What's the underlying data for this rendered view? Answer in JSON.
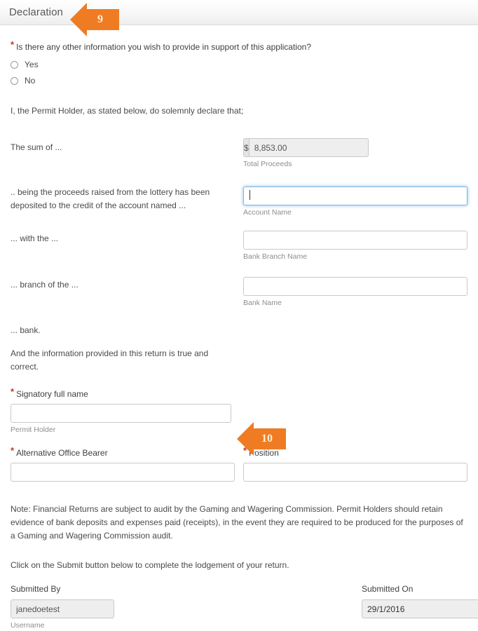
{
  "section": {
    "title": "Declaration"
  },
  "callouts": [
    {
      "number": "9"
    },
    {
      "number": "10"
    }
  ],
  "other_info": {
    "question": "Is there any other information you wish to provide in support of this application?",
    "required": true,
    "options": [
      {
        "label": "Yes",
        "selected": false
      },
      {
        "label": "No",
        "selected": false
      }
    ]
  },
  "declaration_intro": "I, the Permit Holder, as stated below, do solemnly declare that;",
  "declaration_rows": [
    {
      "label": "The sum of ...",
      "field": {
        "type": "currency",
        "addon": "$",
        "value": "8,853.00",
        "readonly": true,
        "help": "Total Proceeds",
        "focused": false
      }
    },
    {
      "label": ".. being the proceeds raised from the lottery has been deposited to the credit of the account named ...",
      "field": {
        "type": "text",
        "value": "",
        "readonly": false,
        "help": "Account Name",
        "focused": true
      }
    },
    {
      "label": "... with the ...",
      "field": {
        "type": "text",
        "value": "",
        "readonly": false,
        "help": "Bank Branch Name",
        "focused": false
      }
    },
    {
      "label": "... branch of the ...",
      "field": {
        "type": "text",
        "value": "",
        "readonly": false,
        "help": "Bank Name",
        "focused": false
      }
    }
  ],
  "bank_closing": "... bank.",
  "truth_statement": "And the information provided in this return is true and correct.",
  "signatory": {
    "label": "Signatory full name",
    "required": true,
    "value": "",
    "help": "Permit Holder"
  },
  "alt_office_bearer": {
    "label": "Alternative Office Bearer",
    "required": true,
    "value": ""
  },
  "position": {
    "label": "Position",
    "required": true,
    "value": ""
  },
  "note": "Note: Financial Returns are subject to audit by the Gaming and Wagering Commission. Permit Holders should retain evidence of bank deposits and expenses paid (receipts), in the event they are required to be produced for the purposes of a Gaming and Wagering Commission audit.",
  "submit_instruction": "Click on the Submit button below to complete the lodgement of your return.",
  "submitted_by": {
    "label": "Submitted By",
    "value": "janedoetest",
    "help": "Username"
  },
  "submitted_on": {
    "label": "Submitted On",
    "value": "29/1/2016",
    "icon": "calendar-icon"
  },
  "colors": {
    "accent_orange": "#ef7c23",
    "required_red": "#cc3322",
    "focus_blue": "#7db5e0"
  }
}
